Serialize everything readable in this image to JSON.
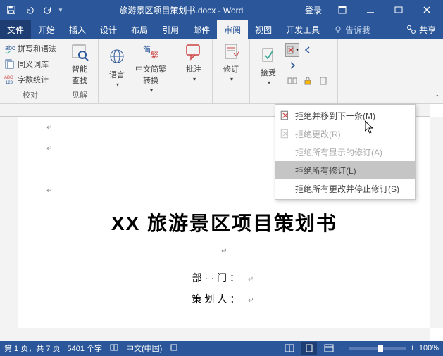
{
  "titlebar": {
    "filename": "旅游景区项目策划书.docx - Word",
    "login": "登录"
  },
  "menu": {
    "file": "文件",
    "home": "开始",
    "insert": "插入",
    "design": "设计",
    "layout": "布局",
    "references": "引用",
    "mailings": "邮件",
    "review": "审阅",
    "view": "视图",
    "developer": "开发工具",
    "tellme": "告诉我",
    "share": "共享"
  },
  "ribbon": {
    "spelling": "拼写和语法",
    "thesaurus": "同义词库",
    "wordcount": "字数统计",
    "proofing_label": "校对",
    "smartlookup": "智能\n查找",
    "insights_label": "见解",
    "language": "语言",
    "translate": "中文简繁\n转换",
    "comments": "批注",
    "tracking": "修订",
    "accept": "接受",
    "reject_items": {
      "reject_next": "拒绝并移到下一条(M)",
      "reject_change": "拒绝更改(R)",
      "reject_shown": "拒绝所有显示的修订(A)",
      "reject_all": "拒绝所有修订(L)",
      "reject_stop": "拒绝所有更改并停止修订(S)"
    }
  },
  "document": {
    "title": "XX 旅游景区项目策划书",
    "dept": "部··门：",
    "planner": "策划人："
  },
  "statusbar": {
    "page": "第 1 页，共 7 页",
    "words": "5401 个字",
    "lang": "中文(中国)",
    "zoom": "100%"
  }
}
